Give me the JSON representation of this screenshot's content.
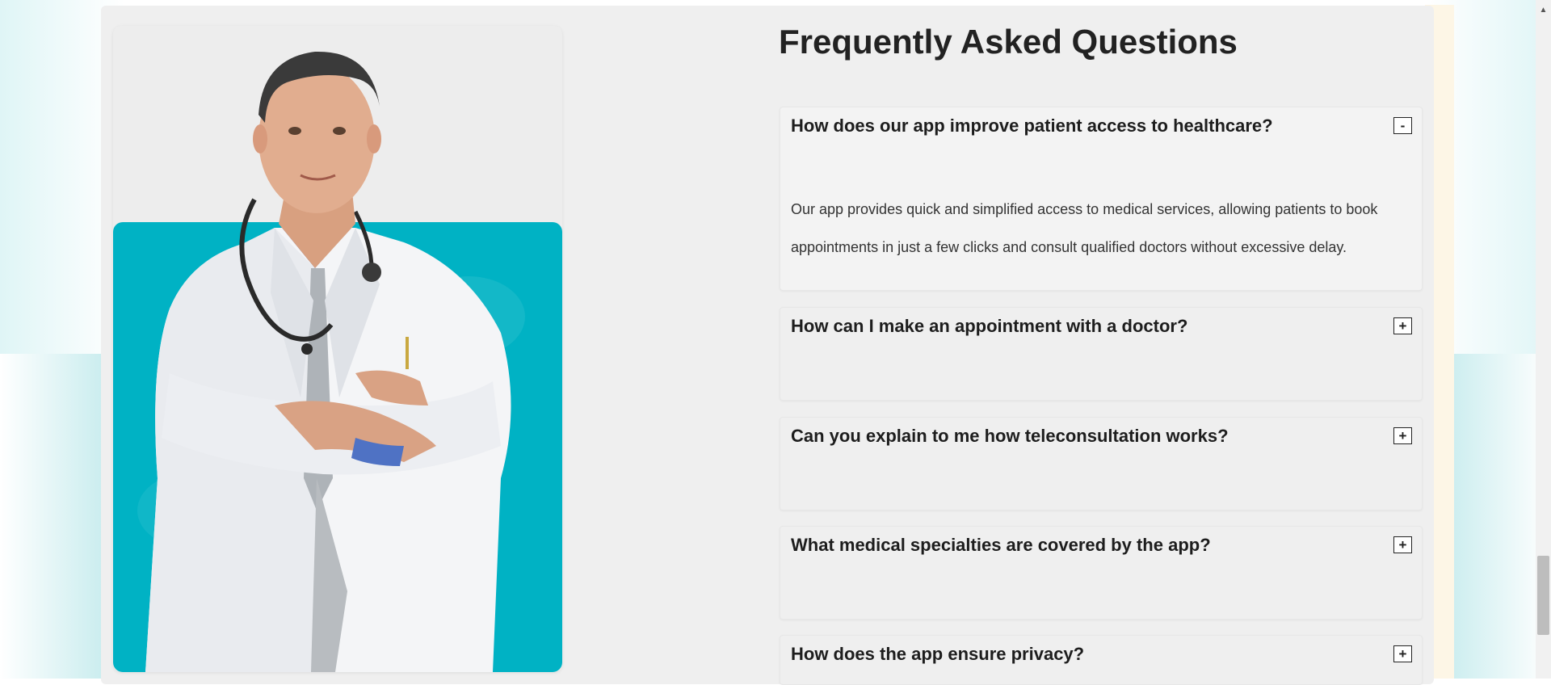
{
  "faq": {
    "title": "Frequently Asked Questions",
    "items": [
      {
        "question": "How does our app improve patient access to healthcare?",
        "toggle": "-",
        "expanded": true,
        "answer": "Our app provides quick and simplified access to medical services, allowing patients to book appointments in just a few clicks and consult qualified doctors without excessive delay."
      },
      {
        "question": "How can I make an appointment with a doctor?",
        "toggle": "+",
        "expanded": false
      },
      {
        "question": "Can you explain to me how teleconsultation works?",
        "toggle": "+",
        "expanded": false
      },
      {
        "question": "What medical specialties are covered by the app?",
        "toggle": "+",
        "expanded": false
      },
      {
        "question": "How does the app ensure privacy?",
        "toggle": "+",
        "expanded": false
      }
    ]
  },
  "colors": {
    "accent_teal": "#00b2c4",
    "section_bg": "#efefef"
  },
  "scrollbar": {
    "up_arrow_icon": "triangle-up-icon"
  }
}
